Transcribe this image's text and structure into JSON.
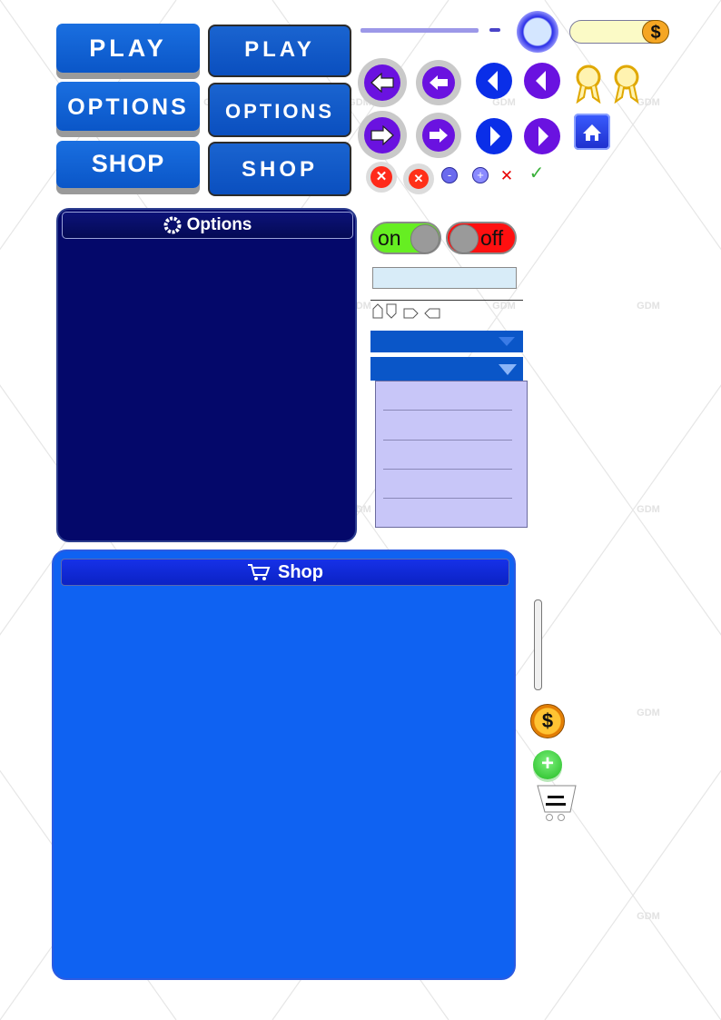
{
  "buttons": {
    "play": "PLAY",
    "options": "OPTIONS",
    "shop": "SHOP"
  },
  "coins": {
    "symbol": "$"
  },
  "options_panel": {
    "title": "Options"
  },
  "shop_panel": {
    "title": "Shop"
  },
  "toggles": {
    "on_label": "on",
    "off_label": "off"
  },
  "watermark": "GDM",
  "colors": {
    "button_blue": "#0a56c8",
    "options_panel_bg": "#04086a",
    "shop_panel_bg": "#0f62f2",
    "arrow_purple": "#6a12e0",
    "arrow_blue": "#0a2ee8",
    "close_red": "#ff2a1a",
    "toggle_on": "#66ee22",
    "toggle_off": "#ff1010",
    "coin_gold": "#f5a623",
    "plus_green": "#33cc33",
    "dropdown_list_bg": "#c8c6f8"
  }
}
